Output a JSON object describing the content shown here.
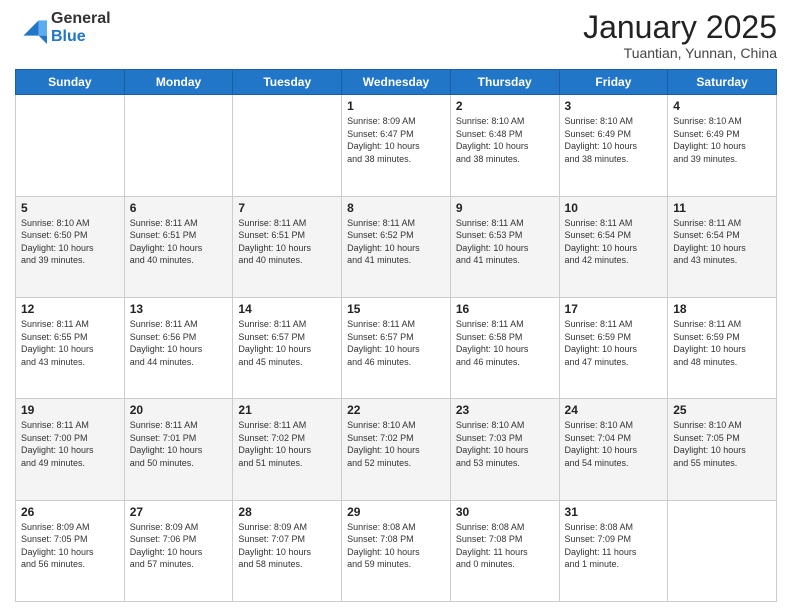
{
  "header": {
    "logo_general": "General",
    "logo_blue": "Blue",
    "month_title": "January 2025",
    "location": "Tuantian, Yunnan, China"
  },
  "days_of_week": [
    "Sunday",
    "Monday",
    "Tuesday",
    "Wednesday",
    "Thursday",
    "Friday",
    "Saturday"
  ],
  "weeks": [
    [
      {
        "day": null
      },
      {
        "day": null
      },
      {
        "day": null
      },
      {
        "day": "1",
        "sunrise": "8:09 AM",
        "sunset": "6:47 PM",
        "daylight": "10 hours and 38 minutes."
      },
      {
        "day": "2",
        "sunrise": "8:10 AM",
        "sunset": "6:48 PM",
        "daylight": "10 hours and 38 minutes."
      },
      {
        "day": "3",
        "sunrise": "8:10 AM",
        "sunset": "6:49 PM",
        "daylight": "10 hours and 38 minutes."
      },
      {
        "day": "4",
        "sunrise": "8:10 AM",
        "sunset": "6:49 PM",
        "daylight": "10 hours and 39 minutes."
      }
    ],
    [
      {
        "day": "5",
        "sunrise": "8:10 AM",
        "sunset": "6:50 PM",
        "daylight": "10 hours and 39 minutes."
      },
      {
        "day": "6",
        "sunrise": "8:11 AM",
        "sunset": "6:51 PM",
        "daylight": "10 hours and 40 minutes."
      },
      {
        "day": "7",
        "sunrise": "8:11 AM",
        "sunset": "6:51 PM",
        "daylight": "10 hours and 40 minutes."
      },
      {
        "day": "8",
        "sunrise": "8:11 AM",
        "sunset": "6:52 PM",
        "daylight": "10 hours and 41 minutes."
      },
      {
        "day": "9",
        "sunrise": "8:11 AM",
        "sunset": "6:53 PM",
        "daylight": "10 hours and 41 minutes."
      },
      {
        "day": "10",
        "sunrise": "8:11 AM",
        "sunset": "6:54 PM",
        "daylight": "10 hours and 42 minutes."
      },
      {
        "day": "11",
        "sunrise": "8:11 AM",
        "sunset": "6:54 PM",
        "daylight": "10 hours and 43 minutes."
      }
    ],
    [
      {
        "day": "12",
        "sunrise": "8:11 AM",
        "sunset": "6:55 PM",
        "daylight": "10 hours and 43 minutes."
      },
      {
        "day": "13",
        "sunrise": "8:11 AM",
        "sunset": "6:56 PM",
        "daylight": "10 hours and 44 minutes."
      },
      {
        "day": "14",
        "sunrise": "8:11 AM",
        "sunset": "6:57 PM",
        "daylight": "10 hours and 45 minutes."
      },
      {
        "day": "15",
        "sunrise": "8:11 AM",
        "sunset": "6:57 PM",
        "daylight": "10 hours and 46 minutes."
      },
      {
        "day": "16",
        "sunrise": "8:11 AM",
        "sunset": "6:58 PM",
        "daylight": "10 hours and 46 minutes."
      },
      {
        "day": "17",
        "sunrise": "8:11 AM",
        "sunset": "6:59 PM",
        "daylight": "10 hours and 47 minutes."
      },
      {
        "day": "18",
        "sunrise": "8:11 AM",
        "sunset": "6:59 PM",
        "daylight": "10 hours and 48 minutes."
      }
    ],
    [
      {
        "day": "19",
        "sunrise": "8:11 AM",
        "sunset": "7:00 PM",
        "daylight": "10 hours and 49 minutes."
      },
      {
        "day": "20",
        "sunrise": "8:11 AM",
        "sunset": "7:01 PM",
        "daylight": "10 hours and 50 minutes."
      },
      {
        "day": "21",
        "sunrise": "8:11 AM",
        "sunset": "7:02 PM",
        "daylight": "10 hours and 51 minutes."
      },
      {
        "day": "22",
        "sunrise": "8:10 AM",
        "sunset": "7:02 PM",
        "daylight": "10 hours and 52 minutes."
      },
      {
        "day": "23",
        "sunrise": "8:10 AM",
        "sunset": "7:03 PM",
        "daylight": "10 hours and 53 minutes."
      },
      {
        "day": "24",
        "sunrise": "8:10 AM",
        "sunset": "7:04 PM",
        "daylight": "10 hours and 54 minutes."
      },
      {
        "day": "25",
        "sunrise": "8:10 AM",
        "sunset": "7:05 PM",
        "daylight": "10 hours and 55 minutes."
      }
    ],
    [
      {
        "day": "26",
        "sunrise": "8:09 AM",
        "sunset": "7:05 PM",
        "daylight": "10 hours and 56 minutes."
      },
      {
        "day": "27",
        "sunrise": "8:09 AM",
        "sunset": "7:06 PM",
        "daylight": "10 hours and 57 minutes."
      },
      {
        "day": "28",
        "sunrise": "8:09 AM",
        "sunset": "7:07 PM",
        "daylight": "10 hours and 58 minutes."
      },
      {
        "day": "29",
        "sunrise": "8:08 AM",
        "sunset": "7:08 PM",
        "daylight": "10 hours and 59 minutes."
      },
      {
        "day": "30",
        "sunrise": "8:08 AM",
        "sunset": "7:08 PM",
        "daylight": "11 hours and 0 minutes."
      },
      {
        "day": "31",
        "sunrise": "8:08 AM",
        "sunset": "7:09 PM",
        "daylight": "11 hours and 1 minute."
      },
      {
        "day": null
      }
    ]
  ],
  "labels": {
    "sunrise_label": "Sunrise:",
    "sunset_label": "Sunset:",
    "daylight_label": "Daylight:"
  }
}
